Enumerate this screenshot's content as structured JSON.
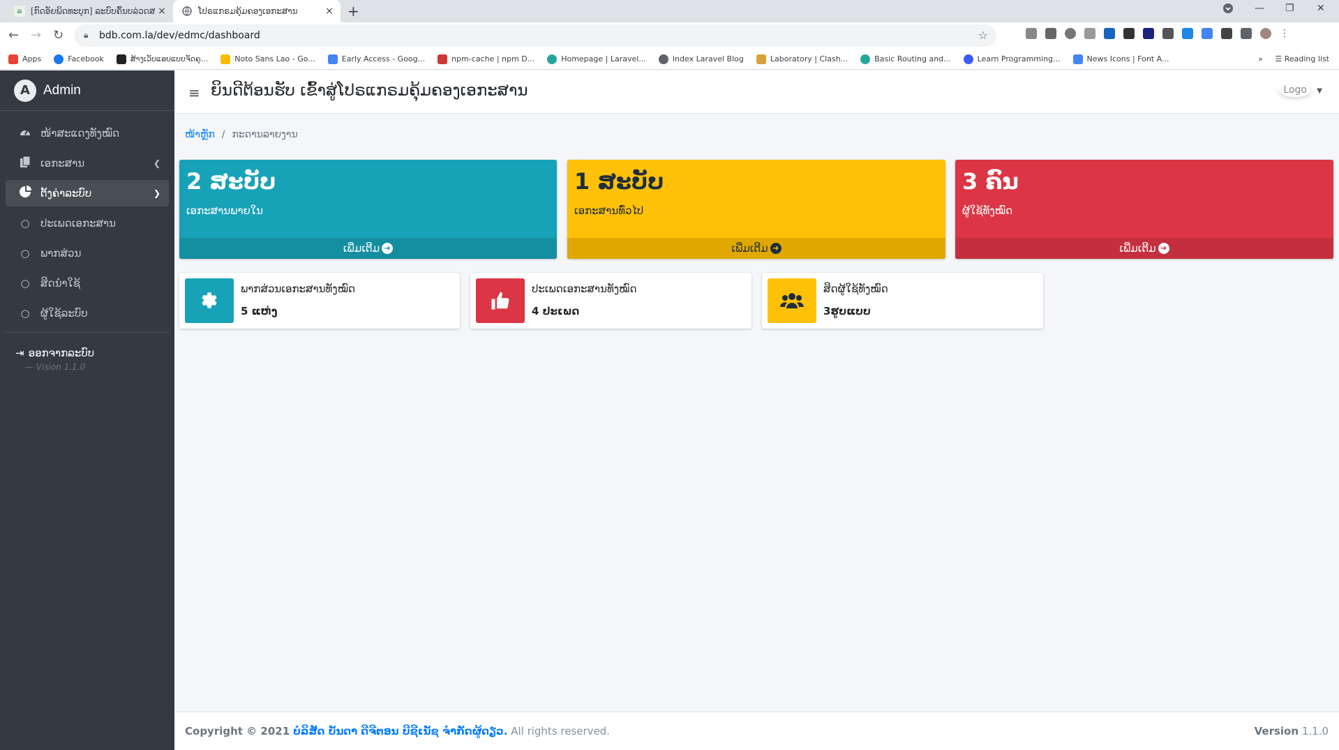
{
  "browser": {
    "tabs": [
      {
        "title": "[ກົດອັຍພິດທະບຸກ] ລະບົບຄົ້ນບລ່ວດສາລ",
        "active": false
      },
      {
        "title": "ໂປຣແກຣມຄຸ້ມຄອງເອກະສານ",
        "active": true
      }
    ],
    "url": "bdb.com.la/dev/edmc/dashboard",
    "bookmarks": [
      "Apps",
      "Facebook",
      "ສ້າງເວັບແອບແບບຈັດຄຸ...",
      "Noto Sans Lao - Go...",
      "Early Access - Goog...",
      "npm-cache | npm D...",
      "Homepage | Laravel...",
      "Index Laravel Blog",
      "Laboratory | Clash...",
      "Basic Routing and...",
      "Learn Programming...",
      "News Icons | Font A..."
    ],
    "reading_list": "Reading list"
  },
  "sidebar": {
    "brand": "Admin",
    "items": [
      {
        "label": "ໜ້າສະແດງທັງໝົດ",
        "icon": "tachometer-icon"
      },
      {
        "label": "ເອກະສານ",
        "icon": "copy-icon"
      },
      {
        "label": "ຕັ້ງຄ່າລະບົບ",
        "icon": "chart-pie-icon"
      }
    ],
    "subitems": [
      {
        "label": "ປະເພດເອກະສານ"
      },
      {
        "label": "ພາກສ່ວນ"
      },
      {
        "label": "ສິດນຳໃຊ້"
      },
      {
        "label": "ຜູ້ໃຊ້ລະບົບ"
      }
    ],
    "logout": "ອອກຈາກລະບົບ",
    "version": "— Vision 1.1.0"
  },
  "header": {
    "welcome": "ຍິນດີຕ້ອນຮັບ ເຂົ້າສູ່ໂປຣແກຣມຄຸ້ມຄອງເອກະສານ",
    "logo_alt": "Logo"
  },
  "breadcrumb": {
    "home": "ໜ້າຫຼັກ",
    "current": "ກະດານລາຍງານ"
  },
  "small_boxes": [
    {
      "value": "2 ສະບັບ",
      "label": "ເອກະສານພາຍໃນ",
      "more": "ເພີ່ມເຕີມ"
    },
    {
      "value": "1 ສະບັບ",
      "label": "ເອກະສານທົ່ວໄປ",
      "more": "ເພີ່ມເຕີມ"
    },
    {
      "value": "3 ຄົນ",
      "label": "ຜູ້ໃຊ້ທັງໝົດ",
      "more": "ເພີ່ມເຕີມ"
    }
  ],
  "info_boxes": [
    {
      "text": "ພາກສ່ວນເອກະສານທັງໝົດ",
      "number": "5 ແຫ່ງ",
      "icon": "gear-icon"
    },
    {
      "text": "ປະເພດເອກະສານທັງໝົດ",
      "number": "4 ປະເພດ",
      "icon": "thumbs-up-icon"
    },
    {
      "text": "ສິດຜູ້ໃຊ້ທັງໝົດ",
      "number": "3ຮູບແບບ",
      "icon": "users-icon"
    }
  ],
  "footer": {
    "copyright": "Copyright © 2021",
    "company": "ບໍລິສັດ ບັນດາ ດີຈີຕອນ ບີຊີເນັຊ ຈຳກັດຜູ້ດຽວ.",
    "rights": " All rights reserved.",
    "version_label": "Version",
    "version": "1.1.0"
  },
  "colors": {
    "info": "#17a2b8",
    "warning": "#ffc107",
    "danger": "#dc3545",
    "sidebar": "#343a40"
  }
}
